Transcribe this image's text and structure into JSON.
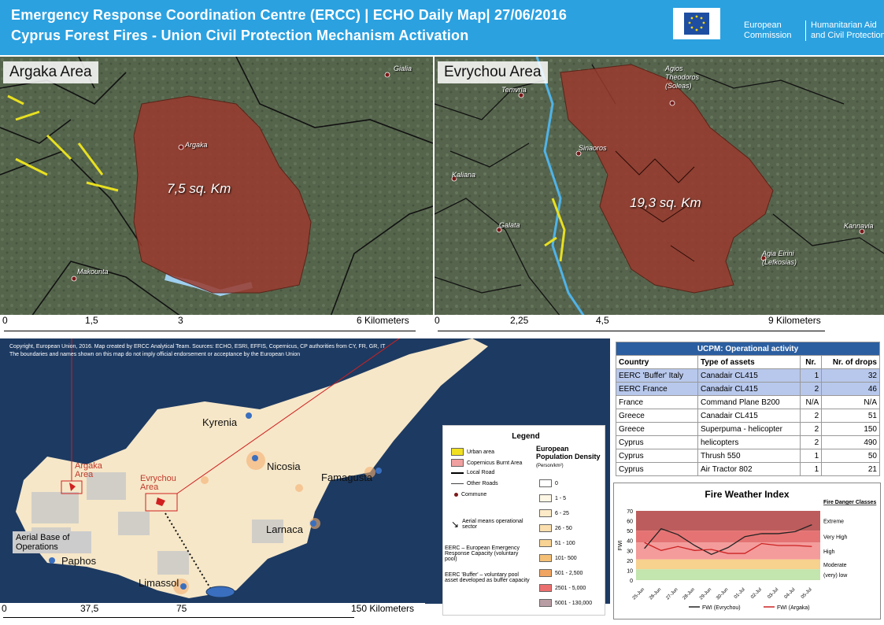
{
  "header": {
    "title_line1": "Emergency Response Coordination  Centre (ERCC) | ECHO Daily Map| 27/06/2016",
    "title_line2": "Cyprus Forest Fires - Union Civil Protection Mechanism Activation",
    "logo_text1": "European\nCommission",
    "logo_text2": "Humanitarian Aid\nand Civil Protection"
  },
  "argaka": {
    "title": "Argaka Area",
    "area_label": "7,5 sq. Km",
    "places": [
      "Gialia",
      "Argaka",
      "Makounta"
    ],
    "scale": [
      "0",
      "1,5",
      "3",
      "6 Kilometers"
    ]
  },
  "evrychou": {
    "title": "Evrychou Area",
    "area_label": "19,3 sq. Km",
    "places": [
      "Agios Theodoros (Soleas)",
      "Temvria",
      "Sinaoros",
      "Kaliana",
      "Galata",
      "Kannavia",
      "Agia Eirini (Lefkosias)"
    ],
    "scale": [
      "0",
      "2,25",
      "4,5",
      "9 Kilometers"
    ]
  },
  "overview": {
    "copyright1": "Copyright, European Union, 2016. Map created by ERCC Analytical Team. Sources: ECHO, ESRI, EFFIS, Copernicus, CP authorities from CY, FR, GR, IT",
    "copyright2": "The boundaries and names shown on this map do not imply official endorsement or acceptance by the European Union",
    "cities": [
      "Kyrenia",
      "Nicosia",
      "Famagusta",
      "Larnaca",
      "Limassol",
      "Paphos"
    ],
    "argaka_label": "Argaka\nArea",
    "evrychou_label": "Evrychou\nArea",
    "aerial_base": "Aerial Base of Operations",
    "scale": [
      "0",
      "37,5",
      "75",
      "150 Kilometers"
    ]
  },
  "legend": {
    "title": "Legend",
    "items": [
      "Urban area",
      "Copernicus Burnt Area",
      "Local Road",
      "Other Roads",
      "Commune",
      "Aerial means operational sector",
      "EERC – European Emergency Response Capacity (voluntary pool)",
      "EERC 'Buffer' – voluntary pool asset developed as buffer capacity"
    ],
    "density_title": "European Population Density",
    "density_unit": "(Person/km²)",
    "density_classes": [
      "0",
      "1 - 5",
      "6 - 25",
      "26 - 50",
      "51 - 100",
      "101- 500",
      "501 - 2,500",
      "2501 - 5,000",
      "5001 - 130,000"
    ],
    "density_colors": [
      "#ffffff",
      "#fff7e6",
      "#fdebc8",
      "#fbdfae",
      "#f9d394",
      "#f5c076",
      "#f1a562",
      "#ec6f6f",
      "#b89ea4"
    ]
  },
  "ucpm": {
    "title": "UCPM: Operational activity",
    "headers": [
      "Country",
      "Type of assets",
      "Nr.",
      "Nr. of drops"
    ],
    "rows": [
      [
        "EERC 'Buffer' Italy",
        "Canadair CL415",
        "1",
        "32"
      ],
      [
        "EERC France",
        "Canadair CL415",
        "2",
        "46"
      ],
      [
        "France",
        "Command Plane B200",
        "N/A",
        "N/A"
      ],
      [
        "Greece",
        "Canadair CL415",
        "2",
        "51"
      ],
      [
        "Greece",
        "Superpuma - helicopter",
        "2",
        "150"
      ],
      [
        "Cyprus",
        "helicopters",
        "2",
        "490"
      ],
      [
        "Cyprus",
        "Thrush 550",
        "1",
        "50"
      ],
      [
        "Cyprus",
        "Air Tractor 802",
        "1",
        "21"
      ]
    ]
  },
  "chart_data": {
    "type": "line",
    "title": "Fire Weather Index",
    "ylabel": "FWI",
    "ylim": [
      0,
      70
    ],
    "yticks": [
      0,
      10,
      20,
      30,
      40,
      50,
      60,
      70
    ],
    "categories": [
      "25-Jun",
      "26-Jun",
      "27-Jun",
      "28-Jun",
      "29-Jun",
      "30-Jun",
      "01-Jul",
      "02-Jul",
      "03-Jul",
      "04-Jul",
      "05-Jul"
    ],
    "series": [
      {
        "name": "FWI (Evrychou)",
        "color": "#222222",
        "values": [
          32,
          52,
          46,
          35,
          26,
          33,
          44,
          47,
          47,
          49,
          56
        ]
      },
      {
        "name": "FWI (Argaka)",
        "color": "#cc2222",
        "values": [
          38,
          30,
          34,
          30,
          31,
          27,
          27,
          37,
          35,
          35,
          34
        ]
      }
    ],
    "danger_classes_title": "Fire Danger Classes",
    "danger_classes": [
      {
        "label": "Extreme",
        "from": 50,
        "to": 70,
        "color": "#b04040"
      },
      {
        "label": "Very High",
        "from": 38,
        "to": 50,
        "color": "#e05a5a"
      },
      {
        "label": "High",
        "from": 21,
        "to": 38,
        "color": "#f28a8a"
      },
      {
        "label": "Moderate",
        "from": 11,
        "to": 21,
        "color": "#f6c97a"
      },
      {
        "label": "(very) low",
        "from": 0,
        "to": 11,
        "color": "#b8e0a0"
      }
    ],
    "legend": "bottom"
  }
}
